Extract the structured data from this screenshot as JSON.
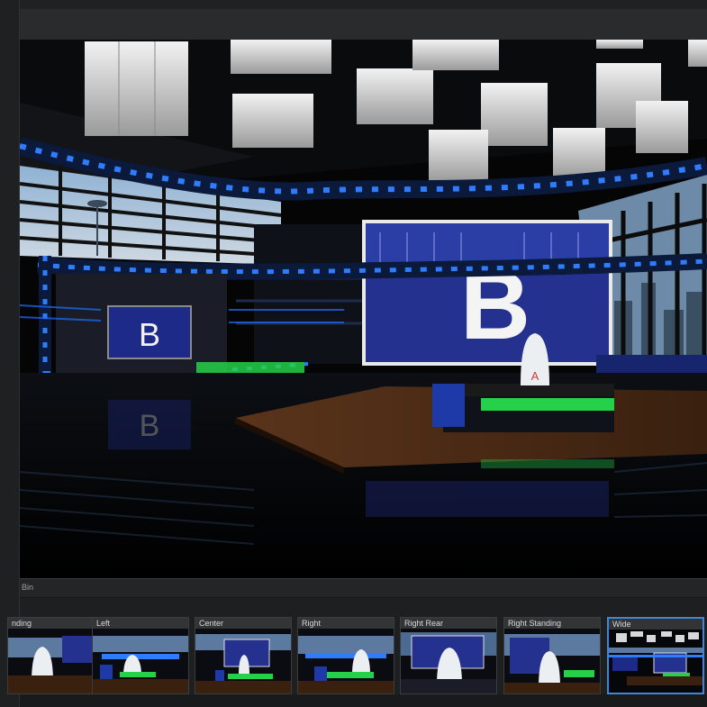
{
  "viewport": {
    "set_letter": "B",
    "anchor_letter": "A"
  },
  "shot_bin": {
    "label": "Bin",
    "selected": "Wide",
    "shots": [
      {
        "label": "nding"
      },
      {
        "label": "Left"
      },
      {
        "label": "Center"
      },
      {
        "label": "Right"
      },
      {
        "label": "Right Rear"
      },
      {
        "label": "Right Standing"
      },
      {
        "label": "Wide"
      }
    ]
  },
  "colors": {
    "accent_blue": "#3d87d8",
    "set_blue": "#1f2f8a",
    "led_blue": "#2f7dff",
    "led_green": "#26d14a",
    "floor_wood": "#4a2a16"
  }
}
